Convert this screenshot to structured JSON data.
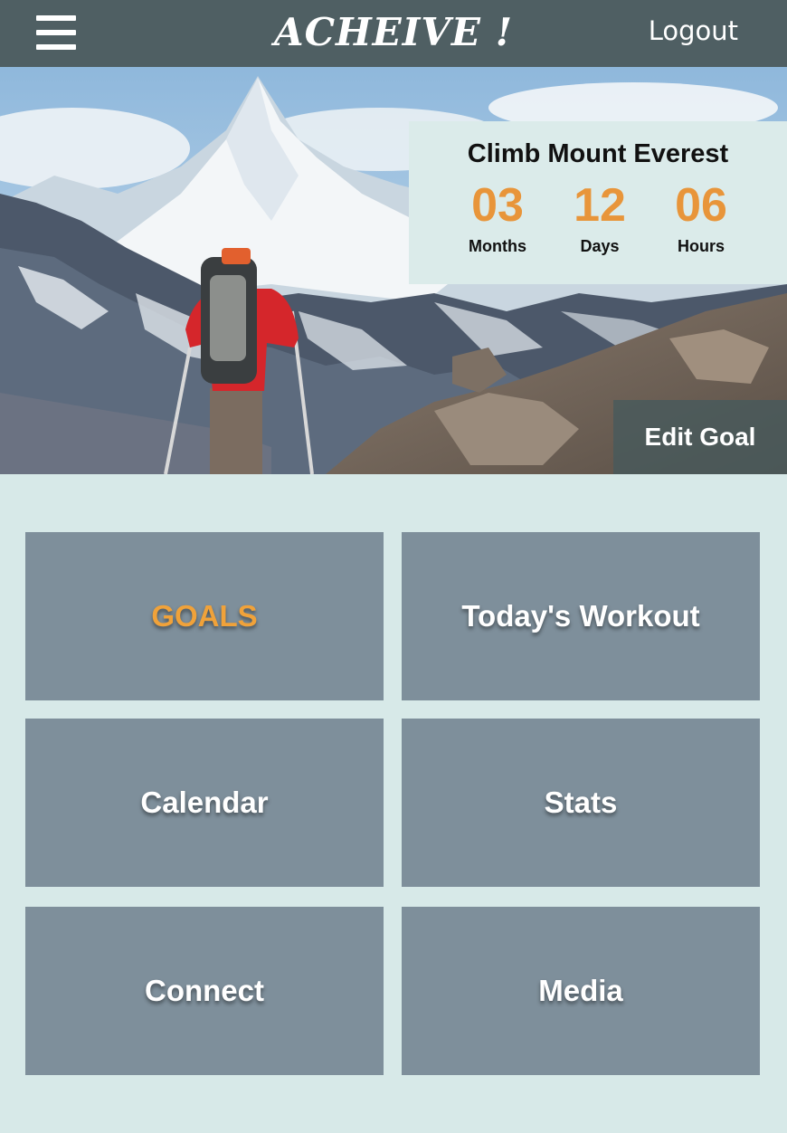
{
  "header": {
    "menu_icon": "hamburger-menu-icon",
    "brand": "ACHEIVE !",
    "logout_label": "Logout",
    "background_color": "#4f5f63"
  },
  "hero": {
    "goal": {
      "title": "Climb Mount Everest",
      "countdown": [
        {
          "value": "03",
          "label": "Months"
        },
        {
          "value": "12",
          "label": "Days"
        },
        {
          "value": "06",
          "label": "Hours"
        }
      ],
      "number_color": "#e8953a"
    },
    "edit_goal_label": "Edit Goal"
  },
  "tiles": [
    {
      "label": "GOALS",
      "active": true
    },
    {
      "label": "Today's Workout",
      "active": false
    },
    {
      "label": "Calendar",
      "active": false
    },
    {
      "label": "Stats",
      "active": false
    },
    {
      "label": "Connect",
      "active": false
    },
    {
      "label": "Media",
      "active": false
    }
  ],
  "colors": {
    "page_background": "#d7e9e8",
    "tile_background": "#7e8f9b",
    "active_tile_text": "#f0a23a"
  }
}
